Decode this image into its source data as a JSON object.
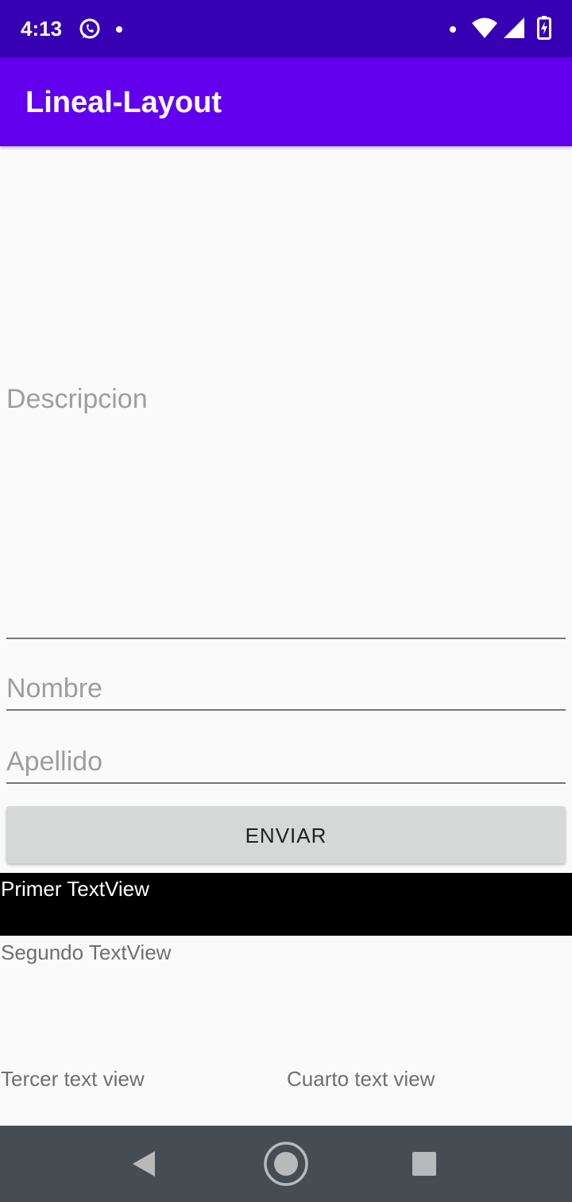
{
  "status_bar": {
    "time": "4:13",
    "icons": [
      "whatsapp-icon",
      "notification-dot-icon",
      "wifi-icon",
      "signal-icon",
      "battery-charging-icon"
    ],
    "background": "#3700b3"
  },
  "app_bar": {
    "title": "Lineal-Layout",
    "background": "#6200ee"
  },
  "form": {
    "descripcion_placeholder": "Descripcion",
    "nombre_placeholder": "Nombre",
    "apellido_placeholder": "Apellido",
    "submit_label": "ENVIAR"
  },
  "text_views": {
    "primer": "Primer TextView",
    "segundo": "Segundo TextView",
    "tercer": "Tercer text view",
    "cuarto": "Cuarto text view"
  },
  "nav_bar": {
    "icons": [
      "back-icon",
      "home-icon",
      "recents-icon"
    ],
    "background": "#454c52"
  }
}
